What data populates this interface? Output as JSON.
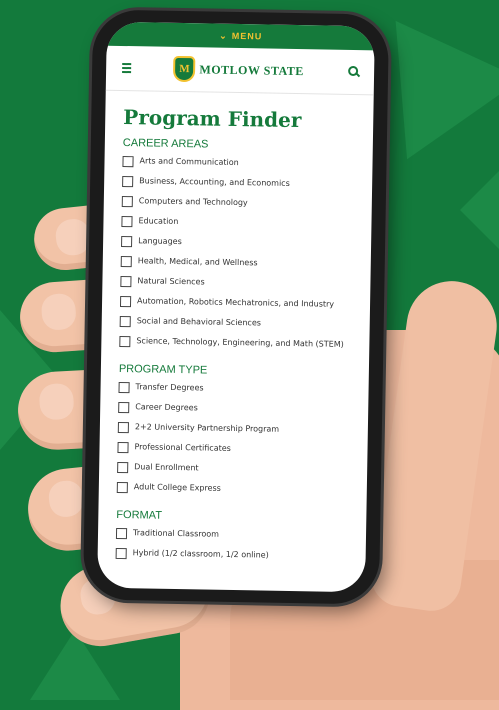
{
  "menu": {
    "label": "MENU"
  },
  "logo": {
    "mark": "M",
    "text": "MOTLOW STATE"
  },
  "page": {
    "title": "Program Finder"
  },
  "sections": {
    "career": {
      "heading": "CAREER AREAS",
      "options": [
        "Arts and Communication",
        "Business, Accounting, and Economics",
        "Computers and Technology",
        "Education",
        "Languages",
        "Health, Medical, and Wellness",
        "Natural Sciences",
        "Automation, Robotics Mechatronics, and Industry",
        "Social and Behavioral Sciences",
        "Science, Technology, Engineering, and Math (STEM)"
      ]
    },
    "program": {
      "heading": "PROGRAM TYPE",
      "options": [
        "Transfer Degrees",
        "Career Degrees",
        "2+2 University Partnership Program",
        "Professional Certificates",
        "Dual Enrollment",
        "Adult College Express"
      ]
    },
    "format": {
      "heading": "FORMAT",
      "options": [
        "Traditional Classroom",
        "Hybrid (1/2 classroom, 1/2 online)"
      ]
    }
  },
  "colors": {
    "brand_green": "#157a3b",
    "brand_gold": "#f2c230",
    "background_green": "#137a3c"
  },
  "icons": {
    "menu_toggle": "chevron-down-icon",
    "nav": "hamburger-icon",
    "search": "search-icon",
    "checkbox": "checkbox-icon"
  }
}
